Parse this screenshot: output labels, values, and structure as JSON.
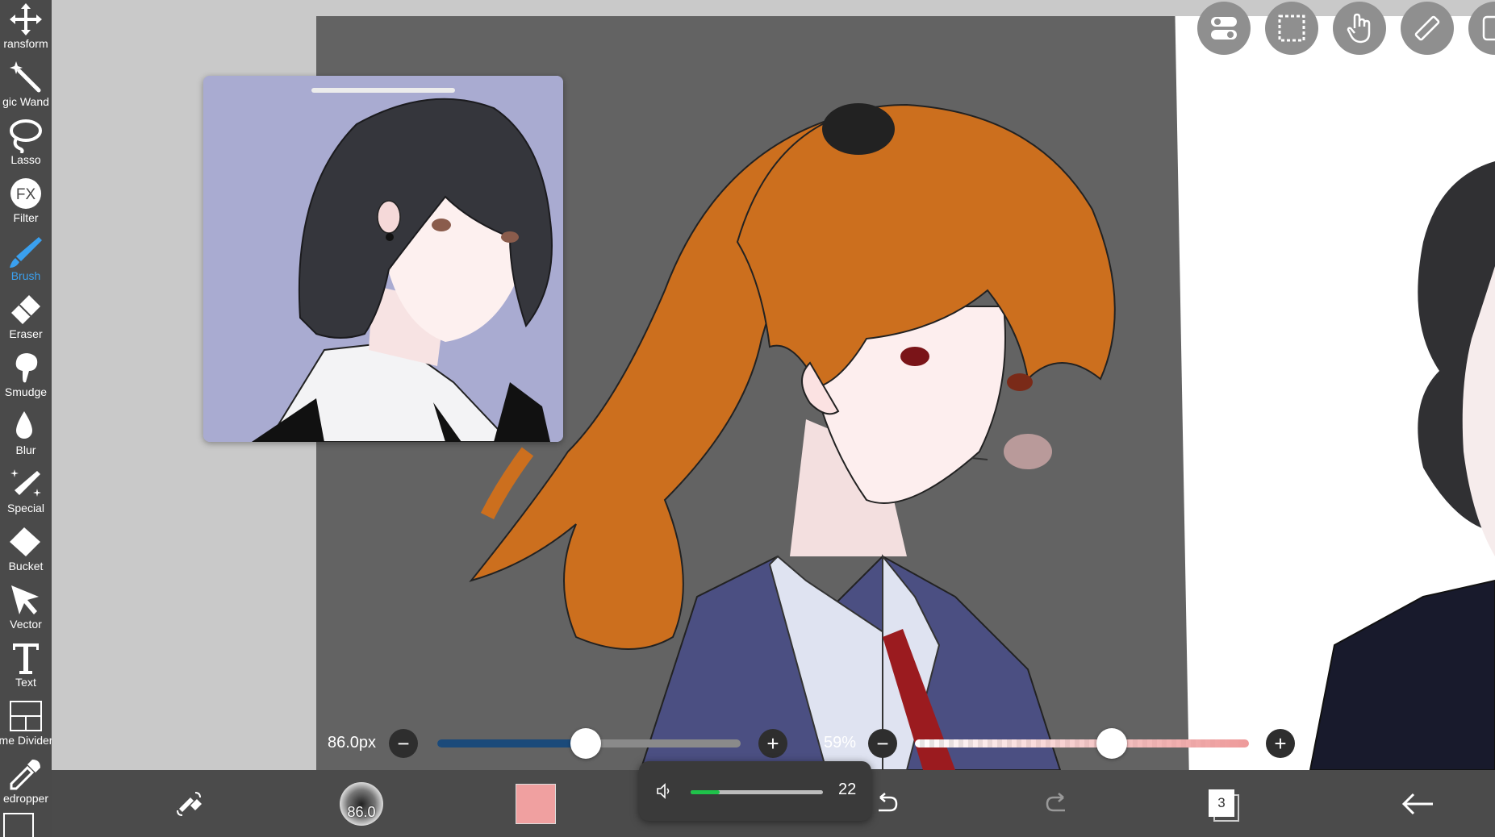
{
  "toolbar": {
    "items": [
      {
        "label": "ransform",
        "icon": "move-arrows-icon"
      },
      {
        "label": "gic Wand",
        "icon": "magic-wand-icon"
      },
      {
        "label": "Lasso",
        "icon": "lasso-icon"
      },
      {
        "label": "Filter",
        "icon": "fx-icon"
      },
      {
        "label": "Brush",
        "icon": "brush-icon"
      },
      {
        "label": "Eraser",
        "icon": "eraser-icon"
      },
      {
        "label": "Smudge",
        "icon": "smudge-icon"
      },
      {
        "label": "Blur",
        "icon": "drop-icon"
      },
      {
        "label": "Special",
        "icon": "sparkle-pen-icon"
      },
      {
        "label": "Bucket",
        "icon": "bucket-icon"
      },
      {
        "label": "Vector",
        "icon": "cursor-arrow-icon"
      },
      {
        "label": "Text",
        "icon": "text-t-icon"
      },
      {
        "label": "me Divider",
        "icon": "frame-divider-icon"
      },
      {
        "label": "edropper",
        "icon": "eyedropper-icon"
      }
    ],
    "active": "Brush",
    "active_color": "#3aa0ef"
  },
  "mode_buttons": [
    "toggle-icon",
    "selection-icon",
    "hand-icon",
    "ruler-icon",
    "layer-icon"
  ],
  "brush_size": {
    "text": "86.0px",
    "value_fraction": 0.49,
    "accent": "#1b4a7a"
  },
  "opacity": {
    "text": "59%",
    "value_fraction": 0.59,
    "accent": "#ee9a9a"
  },
  "bottom_bar": {
    "brush_preview_text": "86.0",
    "color_swatch": "#f0a0a0",
    "layer_count": "3"
  },
  "volume": {
    "level": "22",
    "fill_fraction": 0.22,
    "accent": "#1fc24a"
  }
}
